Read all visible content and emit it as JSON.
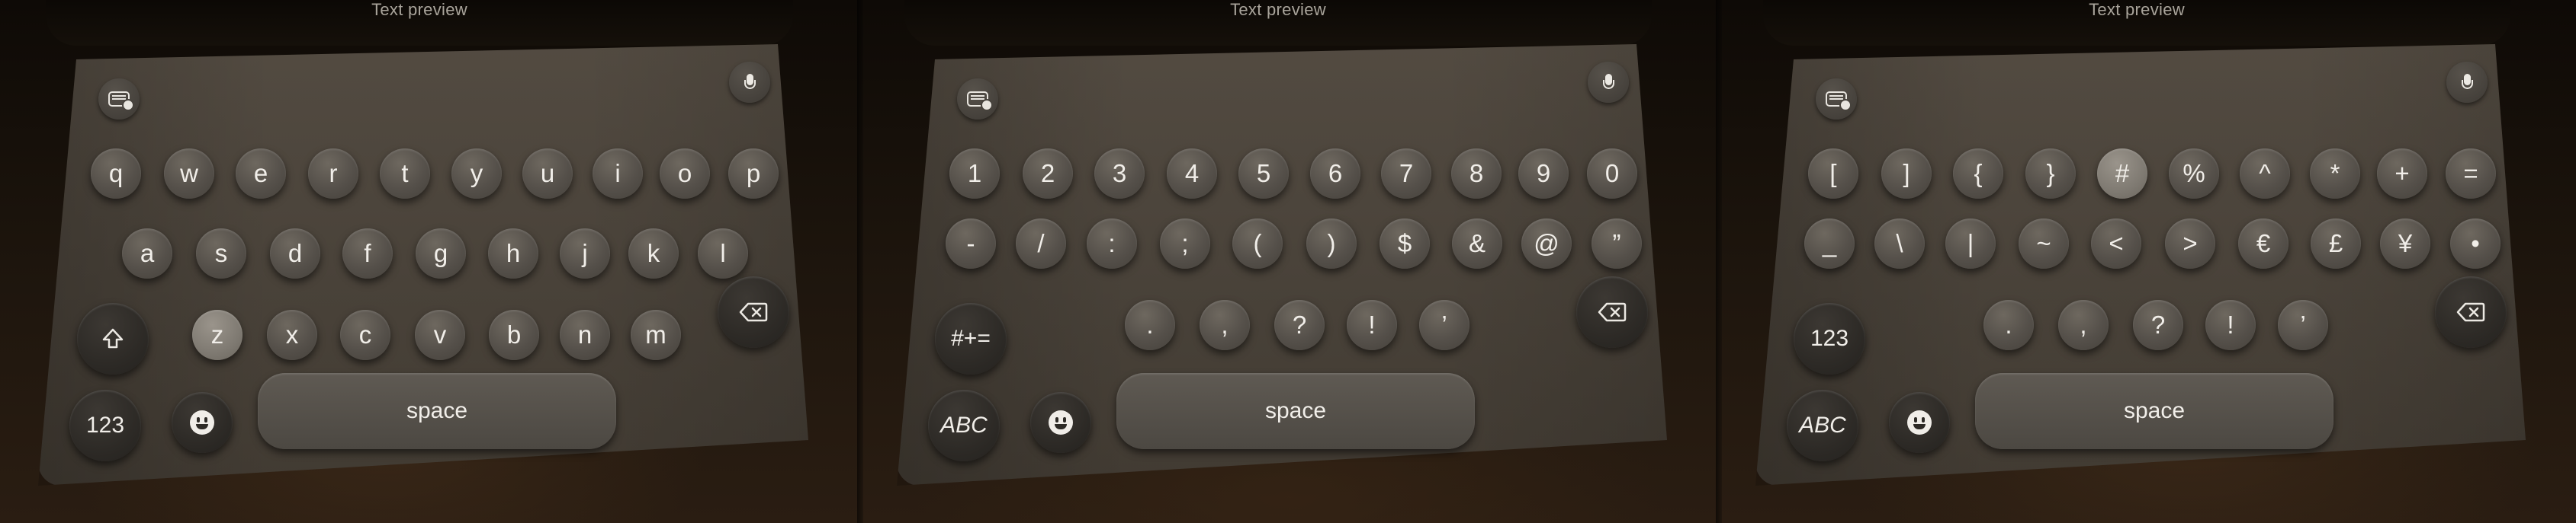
{
  "preview_label": "Text preview",
  "panels": [
    {
      "id": "letters",
      "rows": [
        [
          "q",
          "w",
          "e",
          "r",
          "t",
          "y",
          "u",
          "i",
          "o",
          "p"
        ],
        [
          "a",
          "s",
          "d",
          "f",
          "g",
          "h",
          "j",
          "k",
          "l"
        ],
        [
          "z",
          "x",
          "c",
          "v",
          "b",
          "n",
          "m"
        ]
      ],
      "active_key": "z",
      "mode_key": "123",
      "space_label": "space"
    },
    {
      "id": "numbers",
      "rows": [
        [
          "1",
          "2",
          "3",
          "4",
          "5",
          "6",
          "7",
          "8",
          "9",
          "0"
        ],
        [
          "-",
          "/",
          ":",
          ";",
          "(",
          ")",
          "$",
          "&",
          "@",
          "”"
        ],
        [
          ".",
          ",",
          "?",
          "!",
          "’"
        ]
      ],
      "toggle_key": "#+=",
      "mode_key": "ABC",
      "space_label": "space"
    },
    {
      "id": "symbols",
      "rows": [
        [
          "[",
          "]",
          "{",
          "}",
          "#",
          "%",
          "^",
          "*",
          "+",
          "="
        ],
        [
          "_",
          "\\",
          "|",
          "~",
          "<",
          ">",
          "€",
          "£",
          "¥",
          "•"
        ],
        [
          ".",
          ",",
          "?",
          "!",
          "’"
        ]
      ],
      "active_key": "#",
      "toggle_key": "123",
      "mode_key": "ABC",
      "space_label": "space"
    }
  ],
  "icons": {
    "keyboard": "keyboard-dismiss-icon",
    "mic": "microphone-icon",
    "shift": "shift-icon",
    "delete": "delete-backward-icon",
    "emoji": "emoji-icon"
  }
}
